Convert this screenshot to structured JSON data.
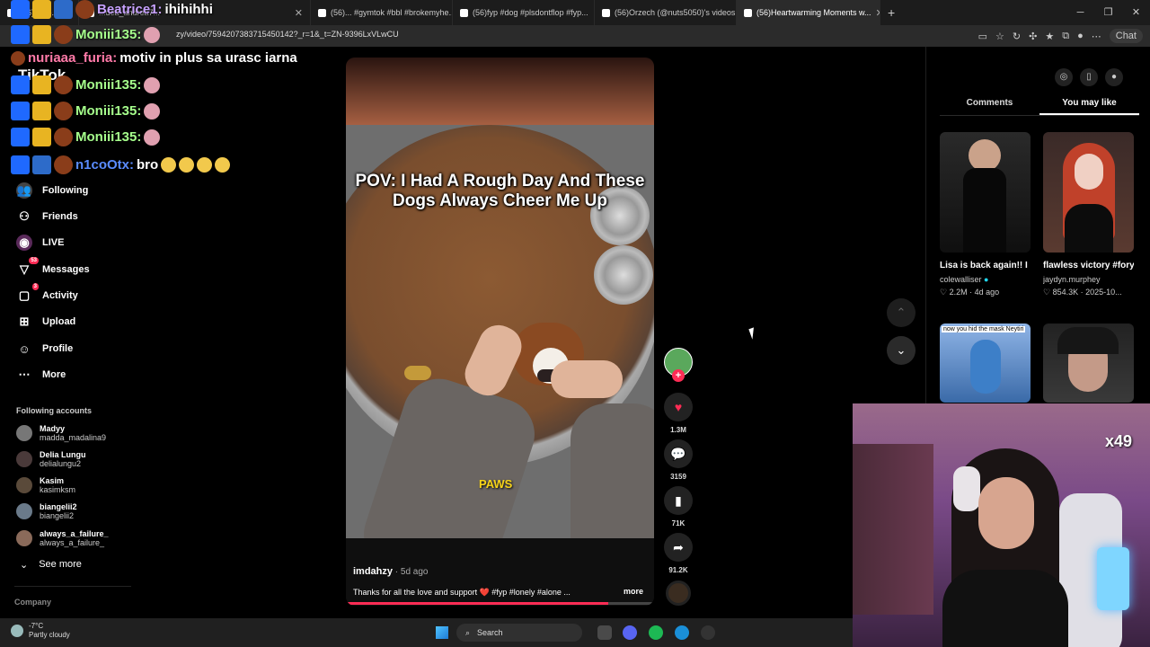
{
  "browser": {
    "tabs": [
      {
        "label": "(56)... ko...",
        "active": false
      },
      {
        "label": "...dea_andrea7...",
        "active": false
      },
      {
        "label": "(56)... #gymtok #bbl #brokemyhe...",
        "active": false
      },
      {
        "label": "(56)fyp #dog #plsdontflop #fyp...",
        "active": false
      },
      {
        "label": "(56)Orzech (@nuts5050)'s videos",
        "active": false
      },
      {
        "label": "(56)Heartwarming Moments w...",
        "active": true
      }
    ],
    "url": "zy/video/7594207383715450142?_r=1&_t=ZN-9396LxVLwCU",
    "chat_button": "Chat"
  },
  "stream_chat": [
    {
      "user": "Beatrice1:",
      "message": "ihihihhi",
      "user_color": "#c8a2ff"
    },
    {
      "user": "Moniii135:",
      "message": "",
      "user_color": "#a6ff8c"
    },
    {
      "user": "nuriaaa_furia:",
      "message": "motiv in plus sa urasc iarna",
      "user_color": "#ff7aa8"
    },
    {
      "user": "Moniii135:",
      "message": "",
      "user_color": "#a6ff8c"
    },
    {
      "user": "Moniii135:",
      "message": "",
      "user_color": "#a6ff8c"
    },
    {
      "user": "Moniii135:",
      "message": "",
      "user_color": "#a6ff8c"
    },
    {
      "user": "n1coOtx:",
      "message": "bro",
      "user_color": "#5a8cff"
    }
  ],
  "tiktok": {
    "logo": "TikTok",
    "nav": [
      {
        "label": "Following",
        "icon": "following-icon"
      },
      {
        "label": "Friends",
        "icon": "friends-icon"
      },
      {
        "label": "LIVE",
        "icon": "live-icon"
      },
      {
        "label": "Messages",
        "icon": "messages-icon",
        "badge": "53"
      },
      {
        "label": "Activity",
        "icon": "activity-icon",
        "badge": "3"
      },
      {
        "label": "Upload",
        "icon": "upload-icon"
      },
      {
        "label": "Profile",
        "icon": "profile-icon"
      },
      {
        "label": "More",
        "icon": "more-icon"
      }
    ],
    "following_title": "Following accounts",
    "following": [
      {
        "name": "Madyy",
        "handle": "madda_madalina9"
      },
      {
        "name": "Delia Lungu",
        "handle": "delialungu2"
      },
      {
        "name": "Kasim",
        "handle": "kasimksm"
      },
      {
        "name": "biangelii2",
        "handle": "biangelii2"
      },
      {
        "name": "always_a_failure_",
        "handle": "always_a_failure_"
      }
    ],
    "see_more": "See more",
    "company": "Company"
  },
  "video": {
    "caption": "POV: I Had A Rough Day And These Dogs Always Cheer Me Up",
    "subtitle": "PAWS",
    "author": "imdahzy",
    "age": " · 5d ago",
    "description": "Thanks for all the love and support ❤️ #fyp #lonely #alone ...",
    "more": "more",
    "progress": 0.85
  },
  "actions": [
    {
      "name": "like",
      "count": "1.3M",
      "icon": "heart-icon",
      "color": "#fe2c55"
    },
    {
      "name": "comment",
      "count": "3159",
      "icon": "comment-icon",
      "color": "#fff"
    },
    {
      "name": "bookmark",
      "count": "71K",
      "icon": "bookmark-icon",
      "color": "#fff"
    },
    {
      "name": "share",
      "count": "91.2K",
      "icon": "share-icon",
      "color": "#fff"
    }
  ],
  "right_panel": {
    "tabs": [
      "Comments",
      "You may like"
    ],
    "active_tab": "You may like",
    "cards": [
      {
        "title": "Lisa is back again!! I mean, no...",
        "author": "colewalliser",
        "stats": "♡ 2.2M · 4d ago",
        "thumb_text": ""
      },
      {
        "title": "flawless victory #foryou #fyp...",
        "author": "jaydyn.murphey",
        "stats": "♡ 854.3K · 2025-10...",
        "thumb_text": ""
      },
      {
        "title": "",
        "author": "",
        "stats": "",
        "thumb_text": "now you hid the mask Neytiri"
      },
      {
        "title": "",
        "author": "",
        "stats": "",
        "thumb_text": ""
      }
    ]
  },
  "overlay": {
    "x_count": "x49"
  },
  "taskbar": {
    "temperature": "-7°C",
    "weather": "Partly cloudy",
    "search": "Search"
  }
}
